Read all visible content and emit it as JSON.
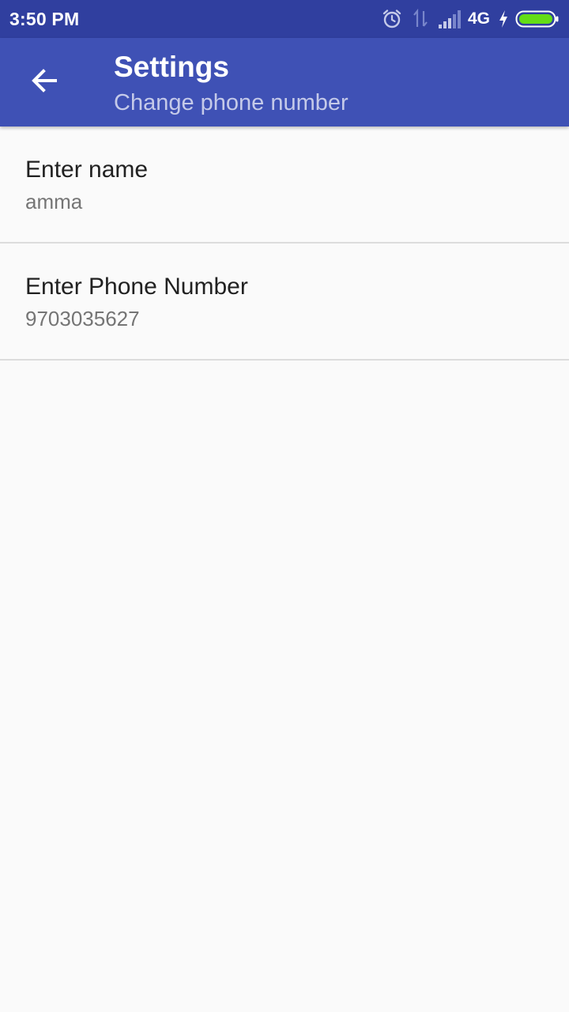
{
  "status_bar": {
    "time": "3:50 PM",
    "network_type": "4G",
    "icons": [
      "alarm-icon",
      "data-transfer-icon",
      "signal-icon",
      "charging-icon",
      "battery-icon"
    ],
    "battery_level": 1.0,
    "colors": {
      "background": "#303f9f",
      "battery_fill": "#64dd17"
    }
  },
  "toolbar": {
    "back_icon": "arrow-back-icon",
    "title": "Settings",
    "subtitle": "Change phone number",
    "colors": {
      "background": "#3f51b5",
      "subtitle": "#c5cae9"
    }
  },
  "preferences": [
    {
      "title": "Enter name",
      "summary": "amma"
    },
    {
      "title": "Enter Phone Number",
      "summary": "9703035627"
    }
  ]
}
